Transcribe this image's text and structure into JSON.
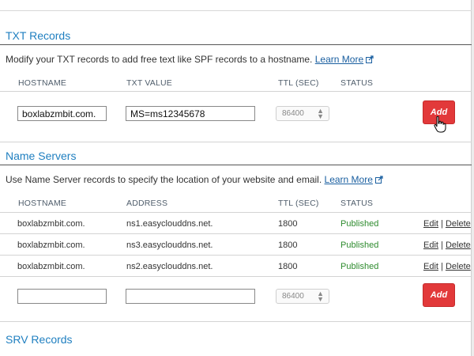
{
  "txt": {
    "title": "TXT Records",
    "description": "Modify your TXT records to add free text like SPF records to a hostname.",
    "learn_more": "Learn More",
    "columns": [
      "HOSTNAME",
      "TXT VALUE",
      "TTL (SEC)",
      "STATUS"
    ],
    "new_row": {
      "hostname": "boxlabzmbit.com.",
      "value": "MS=ms12345678",
      "ttl": "86400"
    },
    "add_label": "Add"
  },
  "ns": {
    "title": "Name Servers",
    "description": "Use Name Server records to specify the location of your website and email.",
    "learn_more": "Learn More",
    "columns": [
      "HOSTNAME",
      "ADDRESS",
      "TTL (SEC)",
      "STATUS"
    ],
    "rows": [
      {
        "hostname": "boxlabzmbit.com.",
        "address": "ns1.easyclouddns.net.",
        "ttl": "1800",
        "status": "Published"
      },
      {
        "hostname": "boxlabzmbit.com.",
        "address": "ns3.easyclouddns.net.",
        "ttl": "1800",
        "status": "Published"
      },
      {
        "hostname": "boxlabzmbit.com.",
        "address": "ns2.easyclouddns.net.",
        "ttl": "1800",
        "status": "Published"
      }
    ],
    "edit_label": "Edit",
    "separator": "|",
    "delete_label": "Delete",
    "new_row": {
      "hostname": "",
      "address": "",
      "ttl": "86400"
    },
    "add_label": "Add"
  },
  "srv": {
    "title": "SRV Records"
  },
  "colors": {
    "accent": "#1f7fc0",
    "add_button": "#e2393a",
    "published": "#2e8b2e"
  },
  "icons": [
    "external-link-icon",
    "chevron-updown-icon",
    "hand-pointer-icon"
  ]
}
